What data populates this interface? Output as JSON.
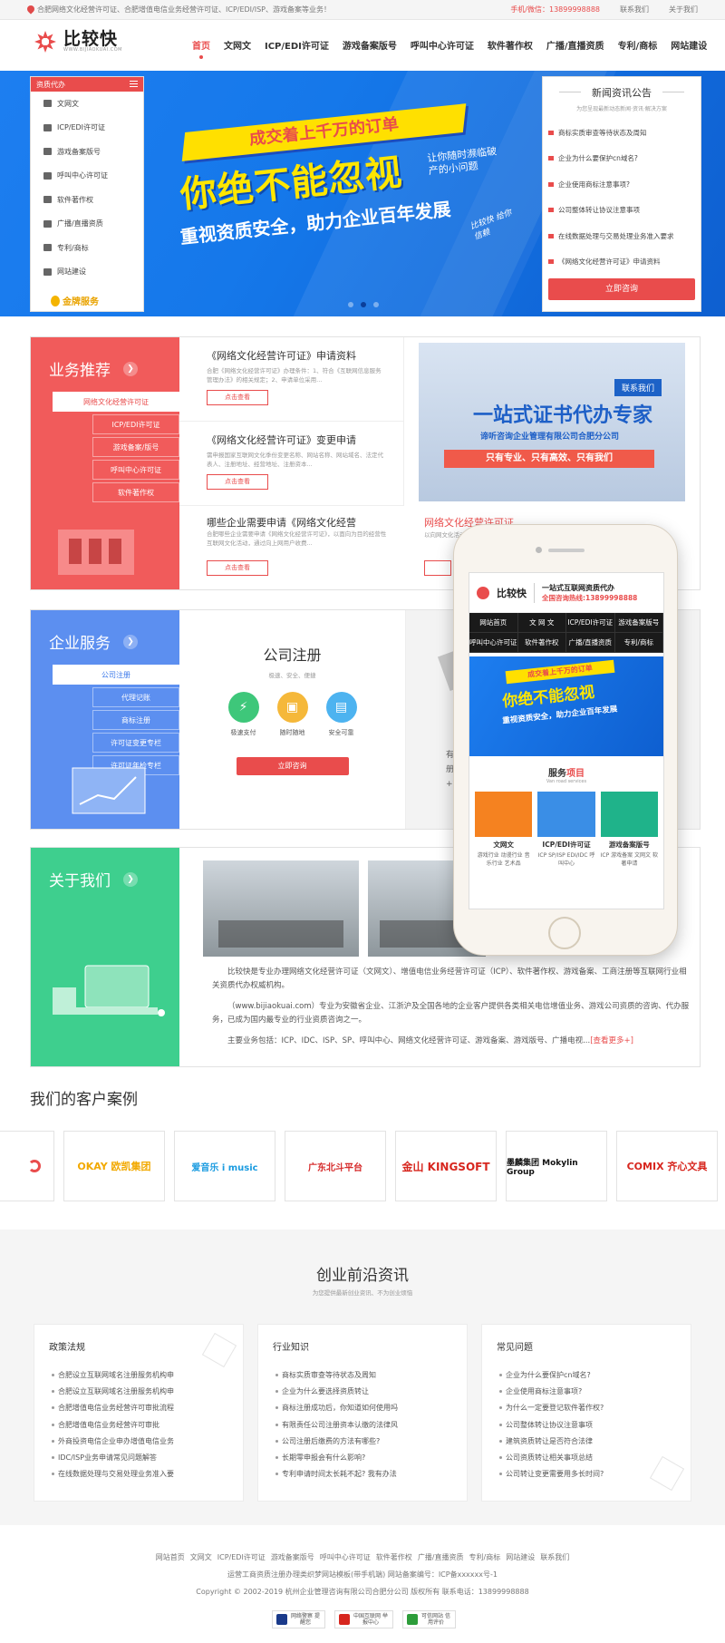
{
  "topbar": {
    "notice": "合肥网络文化经营许可证、合肥增值电信业务经营许可证、ICP/EDI/ISP、游戏备案等业务！",
    "phone": "手机/微信：13899998888",
    "links": [
      "联系我们",
      "关于我们"
    ]
  },
  "header": {
    "logo_text": "比较快",
    "logo_sub": "WWW.BIJIAOKUAI.COM",
    "nav": [
      "首页",
      "文网文",
      "ICP/EDI许可证",
      "游戏备案版号",
      "呼叫中心许可证",
      "软件著作权",
      "广播/直播资质",
      "专利/商标",
      "网站建设"
    ]
  },
  "colors": {
    "accent": "#e94c4c",
    "business": "#f15b5b",
    "service": "#5c8ff0",
    "about": "#3ecf8e",
    "banner": "#1578ea"
  },
  "banner": {
    "menu_title": "资质代办",
    "menu_items": [
      {
        "label": "文网文",
        "icon": "monitor-icon"
      },
      {
        "label": "ICP/EDI许可证",
        "icon": "tag-icon"
      },
      {
        "label": "游戏备案版号",
        "icon": "gamepad-icon"
      },
      {
        "label": "呼叫中心许可证",
        "icon": "headset-icon"
      },
      {
        "label": "软件著作权",
        "icon": "software-icon"
      },
      {
        "label": "广播/直播资质",
        "icon": "user-icon"
      },
      {
        "label": "专利/商标",
        "icon": "folder-icon"
      },
      {
        "label": "网站建设",
        "icon": "browser-icon"
      }
    ],
    "gold": "金牌服务",
    "slogan_top": "成交着上千万的订单",
    "slogan_main": "你绝不能忽视",
    "slogan_side": "让你随时濒临破产的小问题",
    "slogan_sub": "重视资质安全，助力企业百年发展",
    "slogan_sign": "比较快 给你信赖",
    "news_title": "新闻资讯公告",
    "news_sub": "为您呈现最新动态新闻·资讯·解决方案",
    "news_items": [
      "商标实质审查等待状态及周知",
      "企业为什么要保护cn域名?",
      "企业使用商标注意事项?",
      "公司整体转让协议注意事项",
      "在线数据处理与交易处理业务准入要求",
      "《网络文化经营许可证》申请资料"
    ],
    "news_btn": "立即咨询"
  },
  "business": {
    "title": "业务推荐",
    "tabs": [
      "网络文化经营许可证",
      "ICP/EDI许可证",
      "游戏备案/版号",
      "呼叫中心许可证",
      "软件著作权"
    ],
    "items": [
      {
        "title": "《网络文化经营许可证》申请资料",
        "desc": "合肥《网络文化经营许可证》办理条件：1、符合《互联网信息服务管理办法》的相关规定；2、申请单位采用...",
        "btn": "点击查看"
      },
      {
        "title": "《网络文化经营许可证》变更申请",
        "desc": "需申报国家互联网文化季份变更名称、网站名称、网站域名、法定代表人、注册地址、经营地址、注册资本...",
        "btn": "点击查看"
      },
      {
        "title": "哪些企业需要申请《网络文化经营",
        "desc": "合肥哪些企业需要申请《网络文化经营许可证》，以面向为目的经营性互联网文化活动，通过向上网用户收费...",
        "btn": "点击查看"
      },
      {
        "title": "网络文化经营许可证",
        "desc": "以向网文化活动"
      }
    ],
    "ad": {
      "tag": "联系我们",
      "main": "一站式证书代办专家",
      "company": "谛听咨询企业管理有限公司合肥分公司",
      "bar": "只有专业、只有高效、只有我们"
    }
  },
  "service": {
    "title": "企业服务",
    "tabs": [
      "公司注册",
      "代理记账",
      "商标注册",
      "许可证变更专栏",
      "许可证年检专栏"
    ],
    "main_title": "公司注册",
    "main_sub": "极速、安全、便捷",
    "features": [
      {
        "label": "极速支付",
        "icon": "lightning-icon"
      },
      {
        "label": "随时随地",
        "icon": "computer-icon"
      },
      {
        "label": "安全可靠",
        "icon": "card-icon"
      }
    ],
    "btn": "立即咨询",
    "side_text": [
      "有限责",
      "册、合伙企",
      "+银行开户,"
    ]
  },
  "about": {
    "title": "关于我们",
    "p1": "比较快是专业办理网络文化经营许可证（文网文）、增值电信业务经营许可证（ICP）、软件著作权、游戏备案、工商注册等互联网行业相关资质代办权威机构。",
    "p2": "（www.bijiaokuai.com）专业为安徽省企业、江浙沪及全国各地的企业客户提供各类相关电信增值业务、游戏公司资质的咨询、代办服务，已成为国内最专业的行业资质咨询之一。",
    "p3": "主要业务包括：ICP、IDC、ISP、SP、呼叫中心、网络文化经营许可证、游戏备案、游戏版号、广播电视...",
    "more": "[查看更多+]"
  },
  "phone": {
    "logo": "比较快",
    "slogan": "一站式互联网资质代办",
    "hotline": "全国咨询热线:13899998888",
    "nav": [
      "网站首页",
      "文 网 文",
      "ICP/EDI许可证",
      "游戏备案版号",
      "呼叫中心许可证",
      "软件著作权",
      "广播/直播资质",
      "专利/商标"
    ],
    "banner_a": "成交着上千万的订单",
    "banner_b": "你绝不能忽视",
    "banner_c": "重视资质安全，助力企业百年发展",
    "services_title": "服务",
    "services_title_red": "项目",
    "services_sub": "Van road services",
    "cards": [
      {
        "title": "文网文",
        "desc": "游戏行业 动漫行业 音乐行业 艺术品",
        "color": "#f58220"
      },
      {
        "title": "ICP/EDI许可证",
        "desc": "ICP SP/ISP EDI/IDC 呼叫中心",
        "color": "#3a8ee6"
      },
      {
        "title": "游戏备案版号",
        "desc": "ICP 游戏备案 文网文 软著申请",
        "color": "#1fb38a"
      }
    ]
  },
  "clients": {
    "title": "我们的客户案例",
    "logos": [
      {
        "name": "",
        "color": "#e94c4c"
      },
      {
        "name": "OKAY 欧凯集团",
        "color": "#f2a900"
      },
      {
        "name": "爱音乐 i music",
        "color": "#1a9be0"
      },
      {
        "name": "广东北斗平台",
        "color": "#d62b2b"
      },
      {
        "name": "金山 KINGSOFT",
        "color": "#d7261e"
      },
      {
        "name": "墨麟集团 Mokylin Group",
        "color": "#111111"
      },
      {
        "name": "COMIX 齐心文具",
        "color": "#d7261e"
      }
    ]
  },
  "news": {
    "title": "创业前沿资讯",
    "sub": "为您提供最新创业资讯、不为创业烦恼",
    "columns": [
      {
        "title": "政策法规",
        "items": [
          "合肥设立互联网域名注册服务机构申",
          "合肥设立互联网域名注册服务机构申",
          "合肥增值电信业务经营许可审批流程",
          "合肥增值电信业务经营许可审批",
          "外商投资电信企业申办增值电信业务",
          "IDC/ISP业务申请常见问题解答",
          "在线数据处理与交易处理业务准入要"
        ]
      },
      {
        "title": "行业知识",
        "items": [
          "商标实质审查等待状态及周知",
          "企业为什么要选择资质转让",
          "商标注册成功后，你知道如何使用吗",
          "有限责任公司注册资本认缴的法律风",
          "公司注册后缴费的方法有哪些?",
          "长期零申报会有什么影响?",
          "专利申请时间太长耗不起? 我有办法"
        ]
      },
      {
        "title": "常见问题",
        "items": [
          "企业为什么要保护cn域名?",
          "企业使用商标注意事项?",
          "为什么一定要登记软件著作权?",
          "公司整体转让协议注意事项",
          "建筑资质转让是否符合法律",
          "公司资质转让相关事项总结",
          "公司转让变更需要用多长时间?"
        ]
      }
    ]
  },
  "footer": {
    "links": [
      "网站首页",
      "文网文",
      "ICP/EDI许可证",
      "游戏备案版号",
      "呼叫中心许可证",
      "软件著作权",
      "广播/直播资质",
      "专利/商标",
      "网站建设",
      "联系我们"
    ],
    "line1": "运营工商资质注册办理类织梦网站模板(带手机端)   网站备案编号：ICP备xxxxxx号-1",
    "line2": "Copyright © 2002-2019 杭州企业管理咨询有限公司合肥分公司 版权所有  联系电话：13899998888",
    "badges": [
      "网络警察 提醒您",
      "中国互联网 举报中心",
      "可信网站 信用评价"
    ]
  }
}
